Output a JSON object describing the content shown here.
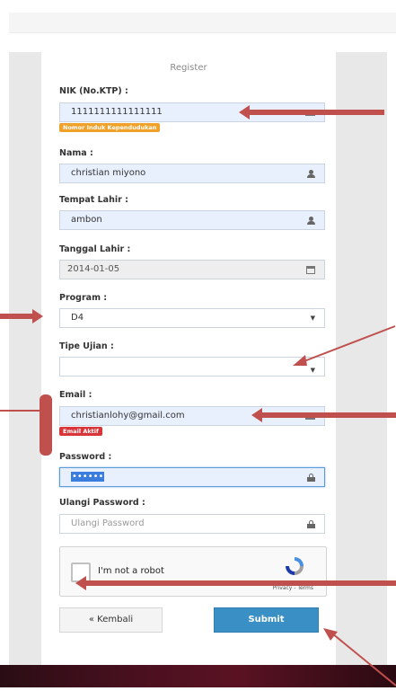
{
  "form": {
    "title": "Register",
    "nik": {
      "label": "NIK (No.KTP) :",
      "value": "1111111111111111",
      "badge": "Nomor Induk Kependudukan"
    },
    "nama": {
      "label": "Nama :",
      "value": "christian miyono"
    },
    "tempat_lahir": {
      "label": "Tempat Lahir :",
      "value": "ambon"
    },
    "tanggal_lahir": {
      "label": "Tanggal Lahir :",
      "value": "2014-01-05"
    },
    "program": {
      "label": "Program :",
      "value": "D4"
    },
    "tipe_ujian": {
      "label": "Tipe Ujian :",
      "value": ""
    },
    "email": {
      "label": "Email :",
      "value": "christianlohy@gmail.com",
      "badge": "Email Aktif"
    },
    "password": {
      "label": "Password :",
      "value": "••••••"
    },
    "ulangi_password": {
      "label": "Ulangi Password :",
      "placeholder": "Ulangi Password"
    },
    "captcha": {
      "text": "I'm not a robot",
      "terms": "Privacy - Terms"
    },
    "back_label": "« Kembali",
    "submit_label": "Submit"
  },
  "colors": {
    "input_blue": "#e8f0fe",
    "submit": "#3a8fc4",
    "badge_orange": "#f0a12a",
    "badge_red": "#d9363b",
    "annotation_arrow": "#c0504d"
  },
  "icons": {
    "nik": "keyboard-icon",
    "nama": "user-icon",
    "tempat_lahir": "user-icon",
    "tanggal_lahir": "calendar-icon",
    "select": "caret-down-icon",
    "email": "envelope-icon",
    "password": "lock-icon",
    "captcha": "recaptcha-logo-icon"
  }
}
